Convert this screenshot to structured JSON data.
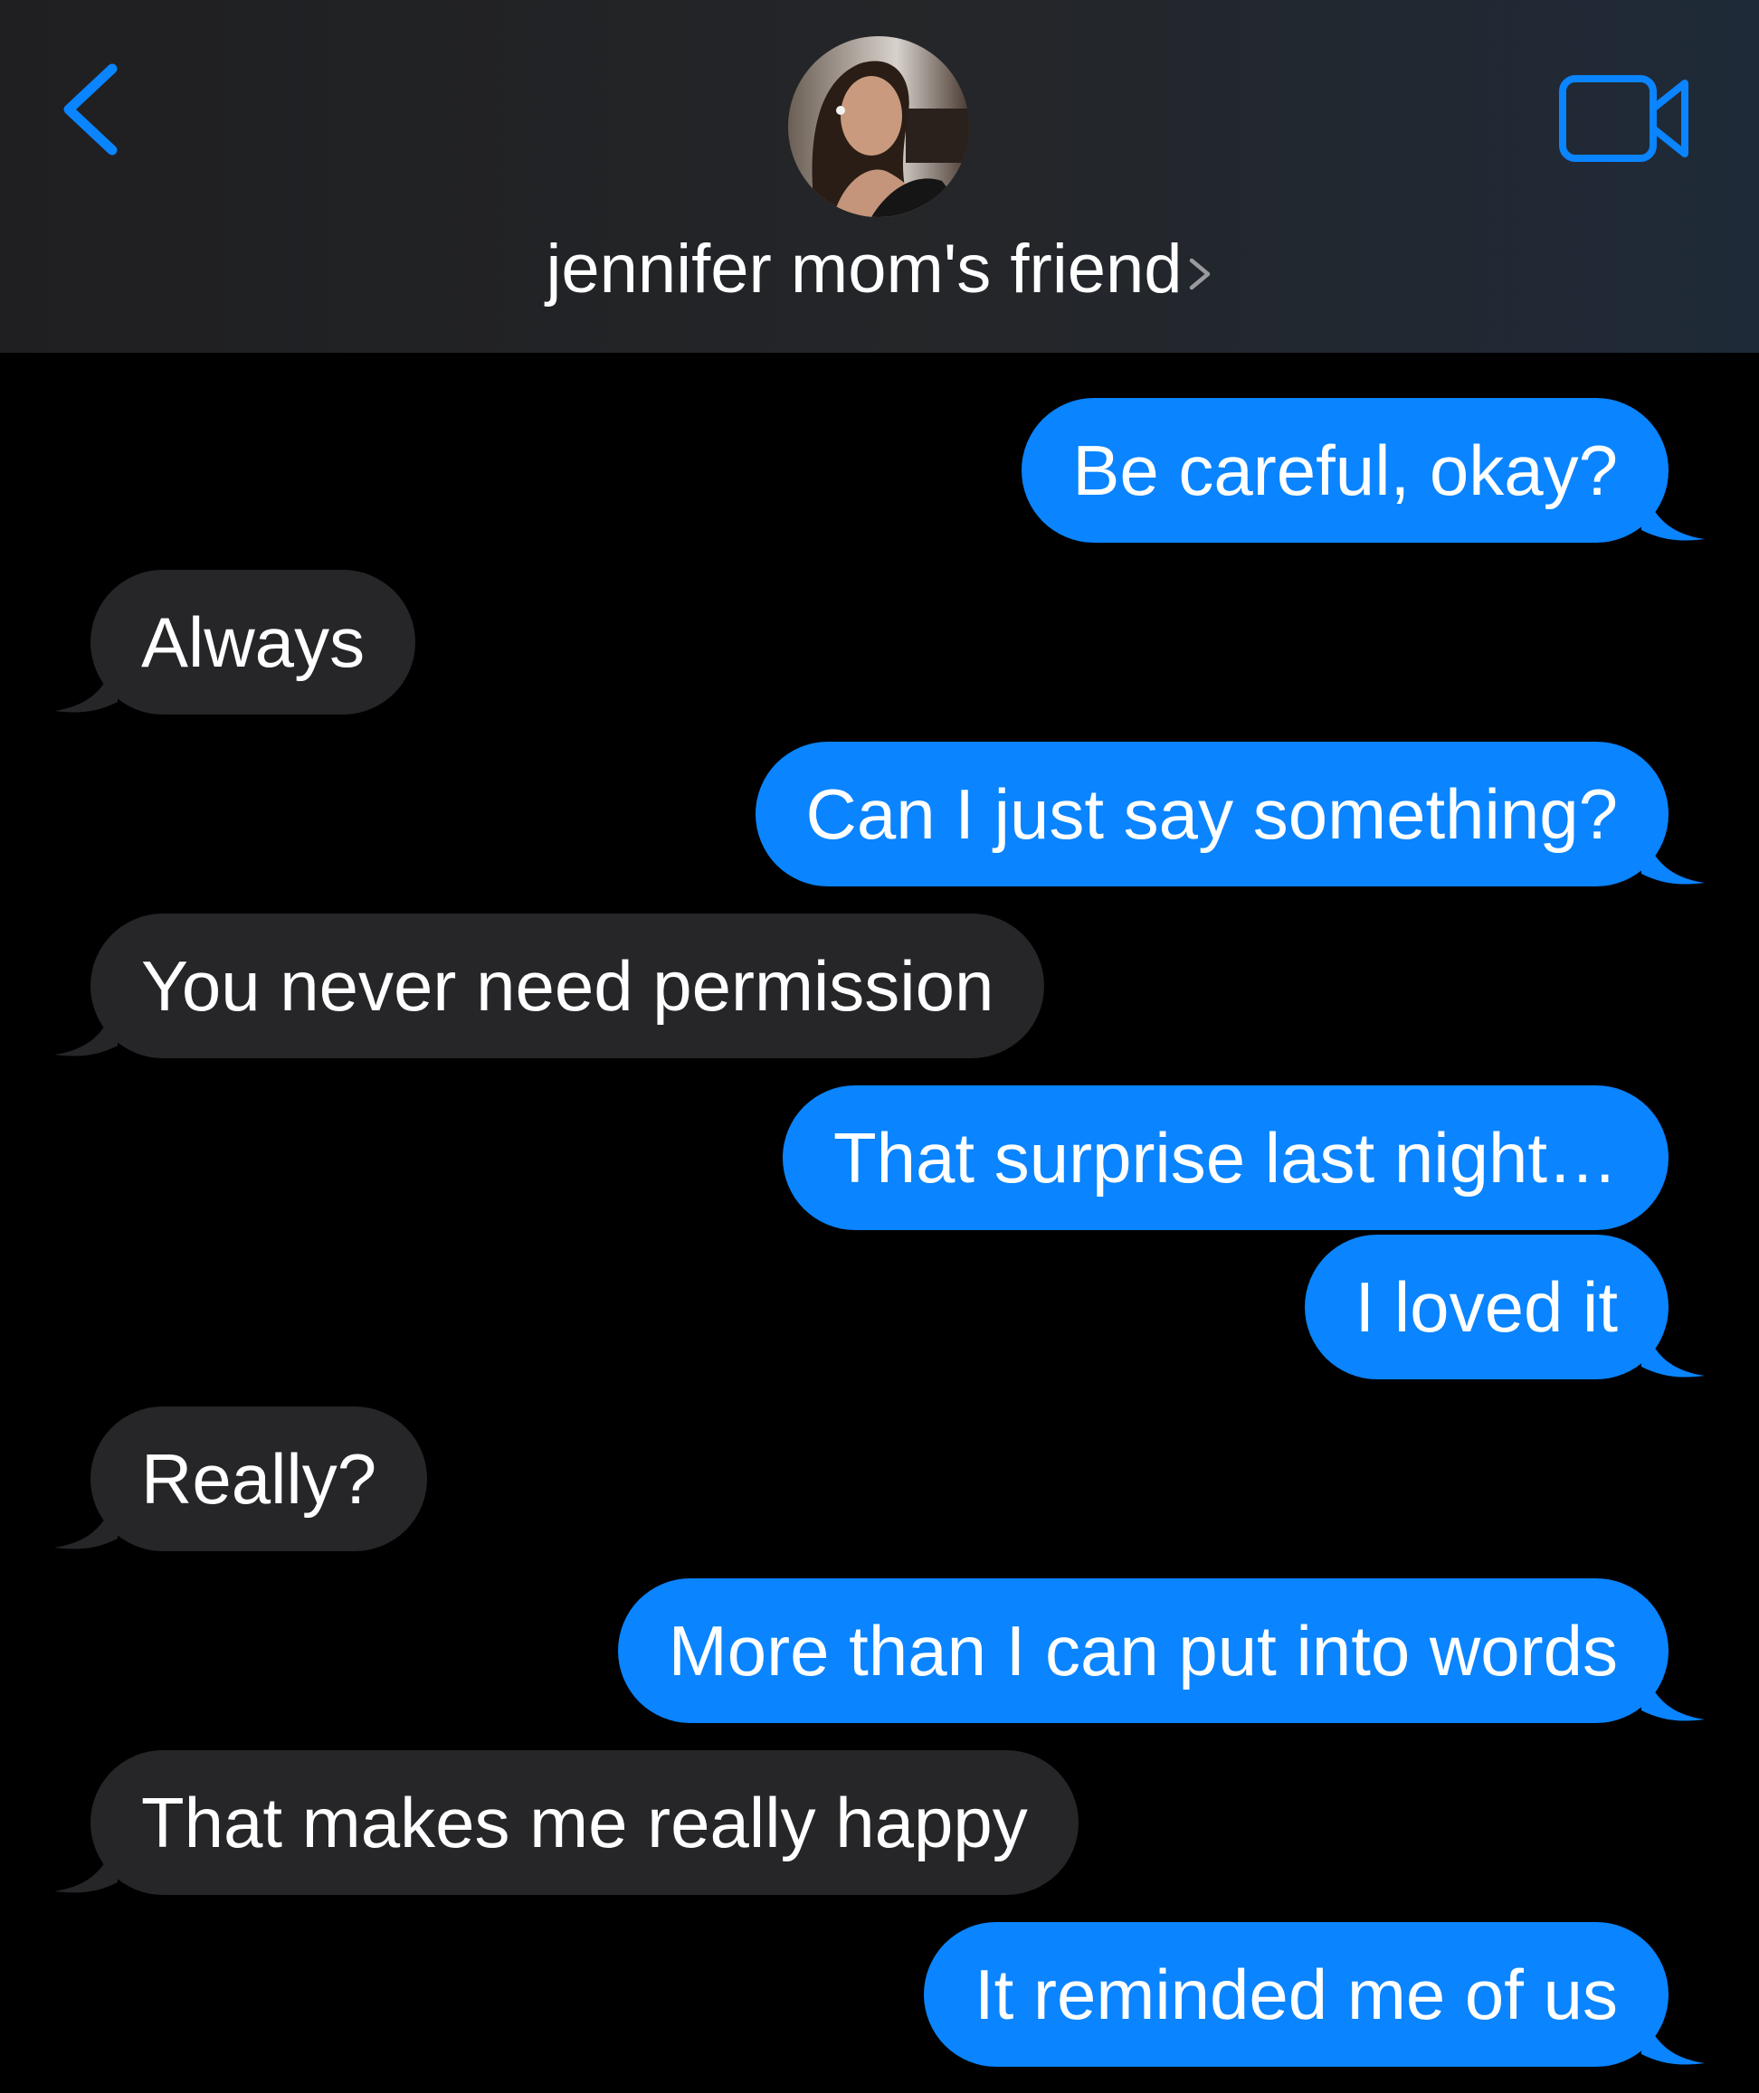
{
  "header": {
    "contact_name": "jennifer mom's friend",
    "back_icon": "chevron-left-icon",
    "video_icon": "video-camera-icon",
    "accent_color": "#0a84ff"
  },
  "messages": [
    {
      "direction": "outgoing",
      "text": "Be careful, okay?"
    },
    {
      "direction": "incoming",
      "text": "Always"
    },
    {
      "direction": "outgoing",
      "text": "Can I just say something?"
    },
    {
      "direction": "incoming",
      "text": "You never need permission"
    },
    {
      "direction": "outgoing",
      "text": "That surprise last night…"
    },
    {
      "direction": "outgoing",
      "text": "I loved it"
    },
    {
      "direction": "incoming",
      "text": "Really?"
    },
    {
      "direction": "outgoing",
      "text": "More than I can put into words"
    },
    {
      "direction": "incoming",
      "text": "That makes me really happy"
    },
    {
      "direction": "outgoing",
      "text": "It reminded me of us"
    }
  ],
  "colors": {
    "outgoing_bubble": "#0a84ff",
    "incoming_bubble": "#262629",
    "background": "#000000"
  }
}
